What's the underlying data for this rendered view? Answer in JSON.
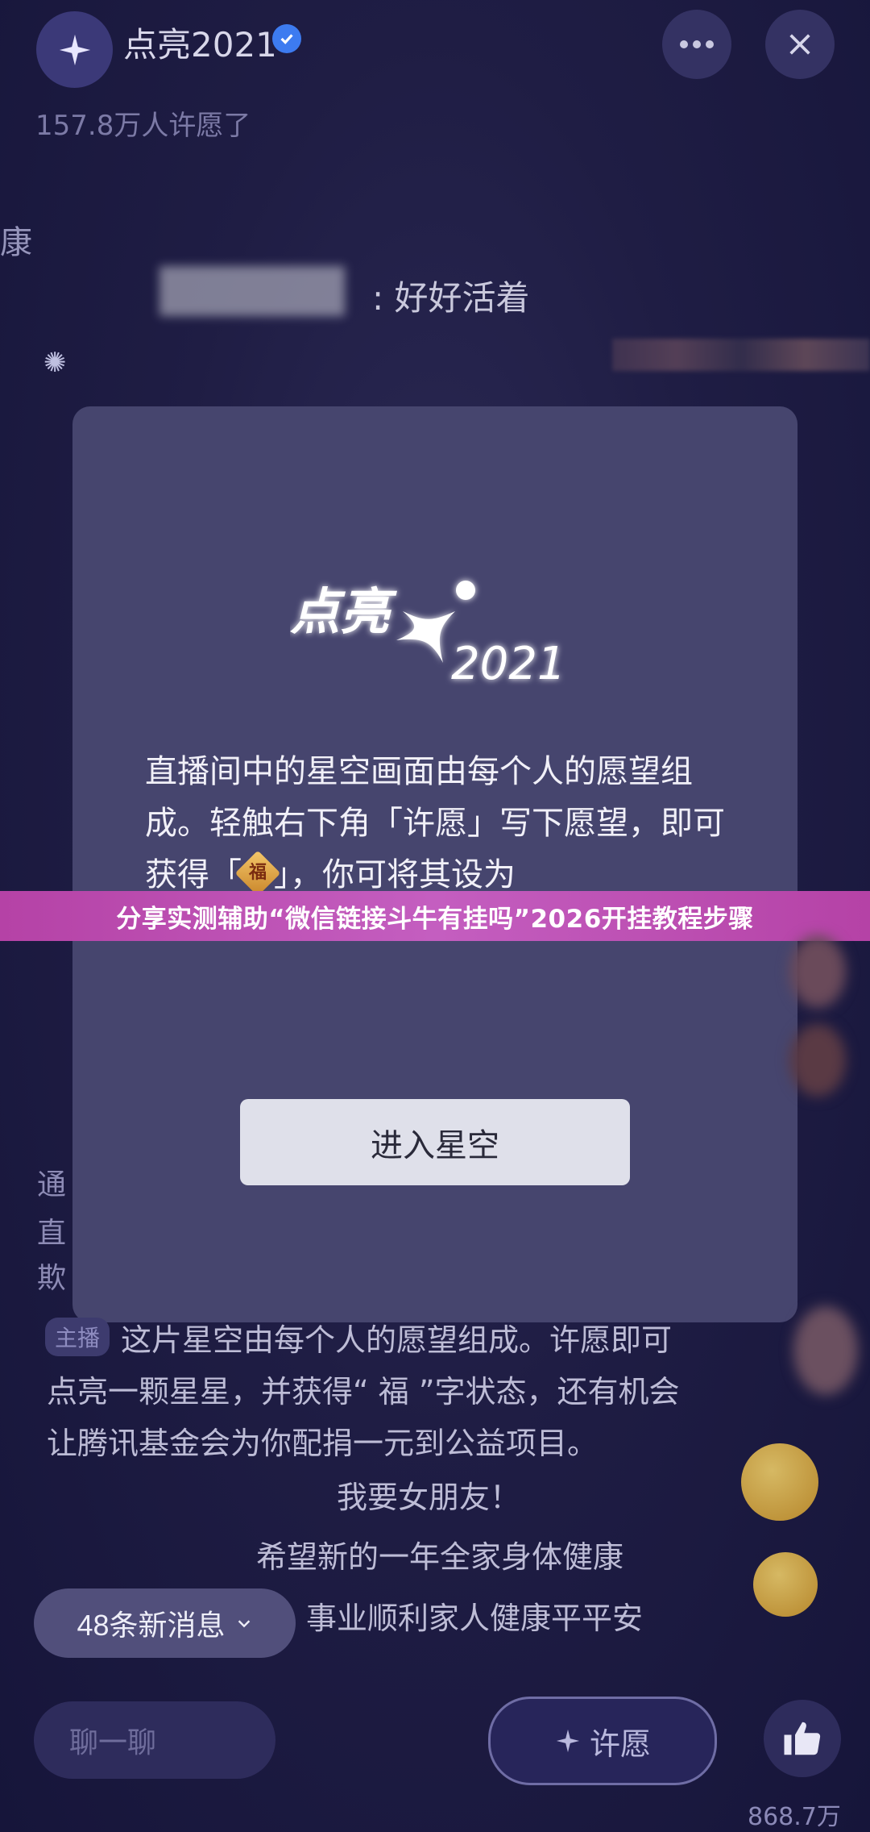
{
  "header": {
    "channel_name": "点亮2021",
    "wish_count": "157.8万人许愿了",
    "more_icon": "more-dots-icon",
    "close_icon": "close-icon"
  },
  "background_chat": {
    "side_char": "康",
    "chat_message": ": 好好活着",
    "host_badge": "主播",
    "host_message": "这片星空由每个人的愿望组成。许愿即可点亮一颗星星，并获得“ 福 ”字状态，还有机会让腾讯基金会为你配捐一元到公益项目。",
    "wishes": [
      "我要女朋友！",
      "希望新的一年全家身体健康",
      "事业顺利家人健康平平安"
    ],
    "partial_left": [
      "通",
      "直",
      "欺"
    ]
  },
  "dialog": {
    "logo_text": "点亮",
    "logo_year": "2021",
    "body_part1": "直播间中的星空画面由每个人的愿望组成。轻触右下角「许愿」写下愿望，即可获得「",
    "fu_char": "福",
    "body_part2": "」，你可将其设为",
    "enter_button": "进入星空"
  },
  "banner": {
    "text": "分享实测辅助“微信链接斗牛有挂吗”2026开挂教程步骤"
  },
  "bottom": {
    "new_messages": "48条新消息",
    "chat_placeholder": "聊一聊",
    "wish_button": "许愿",
    "like_count": "868.7万"
  }
}
